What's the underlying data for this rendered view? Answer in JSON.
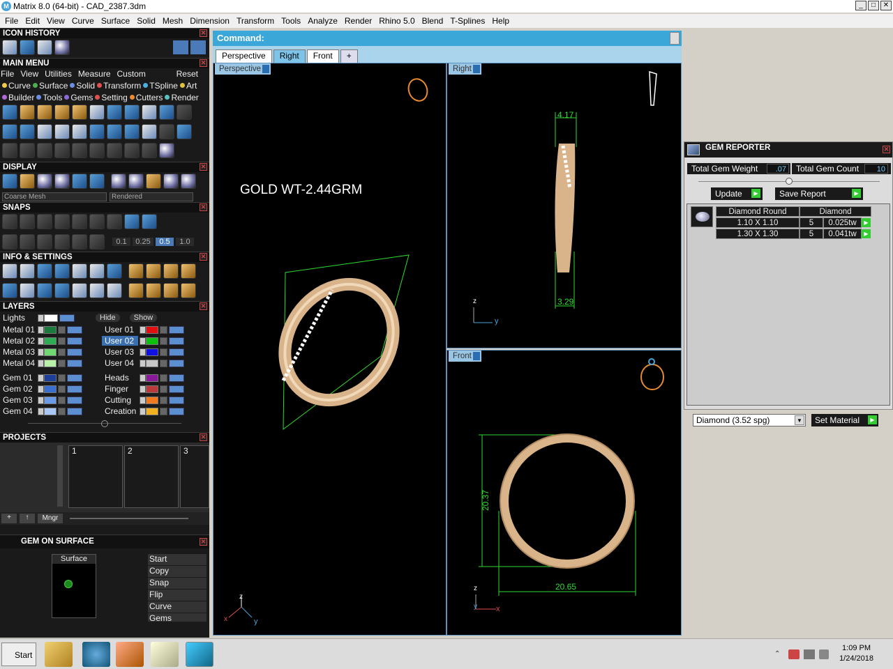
{
  "window": {
    "title": "Matrix 8.0 (64-bit) - CAD_2387.3dm"
  },
  "menu": [
    "File",
    "Edit",
    "View",
    "Curve",
    "Surface",
    "Solid",
    "Mesh",
    "Dimension",
    "Transform",
    "Tools",
    "Analyze",
    "Render",
    "Rhino 5.0",
    "Blend",
    "T-Splines",
    "Help"
  ],
  "icon_history": {
    "title": "ICON HISTORY"
  },
  "main_menu": {
    "title": "MAIN MENU",
    "sub": [
      "File",
      "View",
      "Utilities",
      "Measure",
      "Custom"
    ],
    "reset": "Reset",
    "row1": [
      {
        "label": "Curve",
        "color": "#f2c94c"
      },
      {
        "label": "Surface",
        "color": "#4caf50"
      },
      {
        "label": "Solid",
        "color": "#6b8de3"
      },
      {
        "label": "Transform",
        "color": "#e05050"
      },
      {
        "label": "TSpline",
        "color": "#4ab0e0"
      },
      {
        "label": "Art",
        "color": "#e0c040"
      }
    ],
    "row2": [
      {
        "label": "Builder",
        "color": "#b06ad8"
      },
      {
        "label": "Tools",
        "color": "#6b8de3"
      },
      {
        "label": "Gems",
        "color": "#8a6ad8"
      },
      {
        "label": "Setting",
        "color": "#e05050"
      },
      {
        "label": "Cutters",
        "color": "#f08a30"
      },
      {
        "label": "Render",
        "color": "#5ac0c0"
      }
    ]
  },
  "display": {
    "title": "DISPLAY",
    "mesh": "Coarse Mesh",
    "mode": "Rendered"
  },
  "snaps": {
    "title": "SNAPS",
    "values": [
      "0.1",
      "0.25",
      "0.5",
      "1.0"
    ]
  },
  "info": {
    "title": "INFO & SETTINGS"
  },
  "layers": {
    "title": "LAYERS",
    "lights": "Lights",
    "hide": "Hide",
    "show": "Show",
    "left": [
      {
        "name": "Metal 01",
        "color": "#1b7a3e"
      },
      {
        "name": "Metal 02",
        "color": "#2faa55"
      },
      {
        "name": "Metal 03",
        "color": "#6fd873"
      },
      {
        "name": "Metal 04",
        "color": "#b8f0a8"
      },
      {
        "name": "Gem 01",
        "color": "#1d3f9a"
      },
      {
        "name": "Gem 02",
        "color": "#3a6fd0"
      },
      {
        "name": "Gem 03",
        "color": "#6b9be8"
      },
      {
        "name": "Gem 04",
        "color": "#a9c8f5"
      }
    ],
    "right": [
      {
        "name": "User 01",
        "color": "#e01010"
      },
      {
        "name": "User 02",
        "color": "#10c010"
      },
      {
        "name": "User 03",
        "color": "#1010e0"
      },
      {
        "name": "User 04",
        "color": "#c8c8c8"
      },
      {
        "name": "Heads",
        "color": "#8a1a9a"
      },
      {
        "name": "Finger",
        "color": "#b83a3a"
      },
      {
        "name": "Cutting",
        "color": "#f07a20"
      },
      {
        "name": "Creation",
        "color": "#f0b020"
      }
    ]
  },
  "projects": {
    "title": "PROJECTS",
    "slots": [
      "1",
      "2",
      "3"
    ],
    "mngr": "Mngr"
  },
  "gem_surface": {
    "title": "GEM ON SURFACE",
    "surface": "Surface",
    "actions": [
      "Start",
      "Copy",
      "Snap",
      "Flip",
      "Curve",
      "Gems"
    ]
  },
  "command": {
    "label": "Command:"
  },
  "tabs": [
    "Perspective",
    "Right",
    "Front",
    "+"
  ],
  "viewports": {
    "perspective": {
      "label": "Perspective",
      "annotation": "GOLD WT-2.44GRM"
    },
    "right": {
      "label": "Right",
      "dim_top": "4.17",
      "dim_bottom": "3.29"
    },
    "front": {
      "label": "Front",
      "dim_height": "20.37",
      "dim_width": "20.65"
    }
  },
  "axes": {
    "x": "x",
    "y": "y",
    "z": "z"
  },
  "gem_reporter": {
    "title": "GEM REPORTER",
    "weight_label": "Total Gem Weight",
    "weight": ".07",
    "count_label": "Total Gem Count",
    "count": "10",
    "update": "Update",
    "save": "Save Report",
    "headers": [
      "Diamond Round",
      "Diamond"
    ],
    "rows": [
      {
        "size": "1.10 X 1.10",
        "qty": "5",
        "wt": "0.025tw"
      },
      {
        "size": "1.30 X 1.30",
        "qty": "5",
        "wt": "0.041tw"
      }
    ]
  },
  "material": {
    "value": "Diamond   (3.52 spg)",
    "button": "Set Material"
  },
  "taskbar": {
    "start": "Start",
    "time": "1:09 PM",
    "date": "1/24/2018"
  },
  "colors": {
    "accent": "#3aa7d8",
    "gold": "#e8c9a0",
    "dimension": "#2fdc2f"
  }
}
